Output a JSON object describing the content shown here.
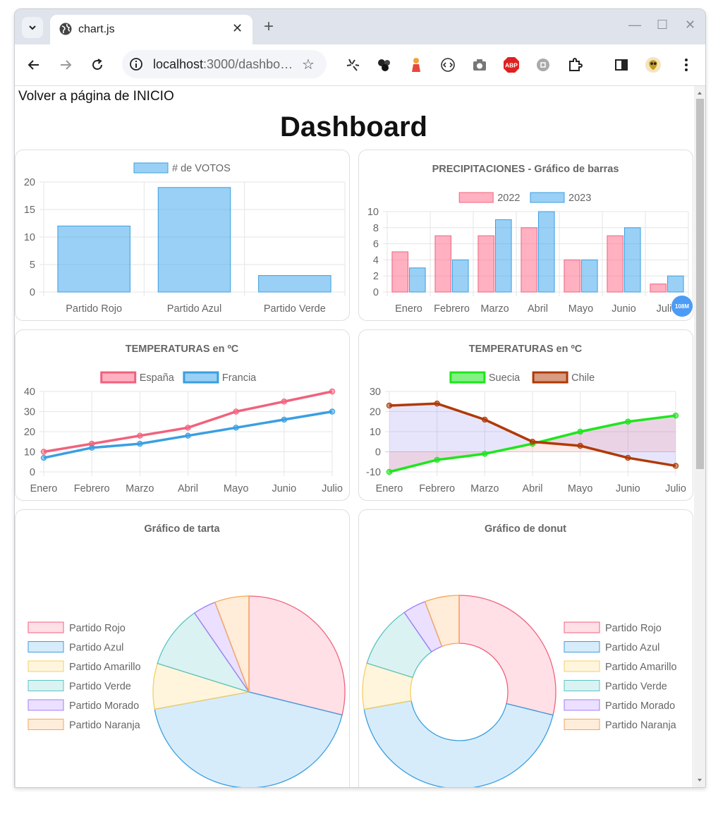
{
  "browser": {
    "tab_title": "chart.js",
    "url_host": "localhost",
    "url_path": ":3000/dashbo…",
    "close_glyph": "✕",
    "newtab_glyph": "+",
    "minimize_glyph": "—",
    "maximize_glyph": "☐",
    "winclose_glyph": "✕",
    "star_glyph": "☆",
    "abp_label": "ABP",
    "memory_badge": "108M"
  },
  "page": {
    "back_link": "Volver a página de INICIO",
    "title": "Dashboard"
  },
  "colors": {
    "red_fill": "rgba(255,99,132,0.5)",
    "red_line": "#f0627d",
    "blue_fill": "rgba(54,162,235,0.5)",
    "blue_line": "#3a9fe0",
    "green_line": "#1ee61e",
    "brown_line": "#b03a06",
    "grid": "#e5e5e5",
    "text": "#666666"
  },
  "chart_data": [
    {
      "id": "votes",
      "type": "bar",
      "title": "",
      "categories": [
        "Partido Rojo",
        "Partido  Azul",
        "Partido Verde"
      ],
      "series": [
        {
          "name": "# de VOTOS",
          "values": [
            12,
            19,
            3
          ],
          "color": "blue"
        }
      ],
      "ylim": [
        0,
        20
      ],
      "yticks": [
        0,
        5,
        10,
        15,
        20
      ],
      "legend": "top",
      "grid": true
    },
    {
      "id": "rain",
      "type": "bar",
      "title": "PRECIPITACIONES - Gráfico de barras",
      "categories": [
        "Enero",
        "Febrero",
        "Marzo",
        "Abril",
        "Mayo",
        "Junio",
        "Julio"
      ],
      "series": [
        {
          "name": "2022",
          "values": [
            5,
            7,
            7,
            8,
            4,
            7,
            1
          ],
          "color": "red"
        },
        {
          "name": "2023",
          "values": [
            3,
            4,
            9,
            10,
            4,
            8,
            2
          ],
          "color": "blue"
        }
      ],
      "ylim": [
        0,
        10
      ],
      "yticks": [
        0,
        2,
        4,
        6,
        8,
        10
      ],
      "legend": "top",
      "grid": true
    },
    {
      "id": "temp1",
      "type": "line",
      "title": "TEMPERATURAS en ºC",
      "categories": [
        "Enero",
        "Febrero",
        "Marzo",
        "Abril",
        "Mayo",
        "Junio",
        "Julio"
      ],
      "series": [
        {
          "name": "España",
          "values": [
            10,
            14,
            18,
            22,
            30,
            35,
            40
          ],
          "color": "red"
        },
        {
          "name": "Francia",
          "values": [
            7,
            12,
            14,
            18,
            22,
            26,
            30
          ],
          "color": "blue"
        }
      ],
      "ylim": [
        0,
        40
      ],
      "yticks": [
        0,
        10,
        20,
        30,
        40
      ],
      "legend": "top",
      "grid": true
    },
    {
      "id": "temp2",
      "type": "line",
      "title": "TEMPERATURAS en ºC",
      "categories": [
        "Enero",
        "Febrero",
        "Marzo",
        "Abril",
        "Mayo",
        "Junio",
        "Julio"
      ],
      "series": [
        {
          "name": "Suecia",
          "values": [
            -10,
            -4,
            -1,
            4,
            10,
            15,
            18
          ],
          "color": "green"
        },
        {
          "name": "Chile",
          "values": [
            23,
            24,
            16,
            5,
            3,
            -3,
            -7
          ],
          "color": "brown"
        }
      ],
      "ylim": [
        -10,
        30
      ],
      "yticks": [
        -10,
        0,
        10,
        20,
        30
      ],
      "legend": "top",
      "grid": true,
      "fill": true
    },
    {
      "id": "pie",
      "type": "pie",
      "title": "Gráfico de tarta",
      "labels": [
        "Partido Rojo",
        "Partido Azul",
        "Partido Amarillo",
        "Partido Verde",
        "Partido Morado",
        "Partido Naranja"
      ],
      "values": [
        30,
        45,
        8,
        11,
        4,
        6
      ],
      "legend": "left"
    },
    {
      "id": "donut",
      "type": "pie",
      "title": "Gráfico de donut",
      "labels": [
        "Partido Rojo",
        "Partido Azul",
        "Partido Amarillo",
        "Partido Verde",
        "Partido Morado",
        "Partido Naranja"
      ],
      "values": [
        30,
        45,
        8,
        11,
        4,
        6
      ],
      "legend": "right"
    }
  ]
}
